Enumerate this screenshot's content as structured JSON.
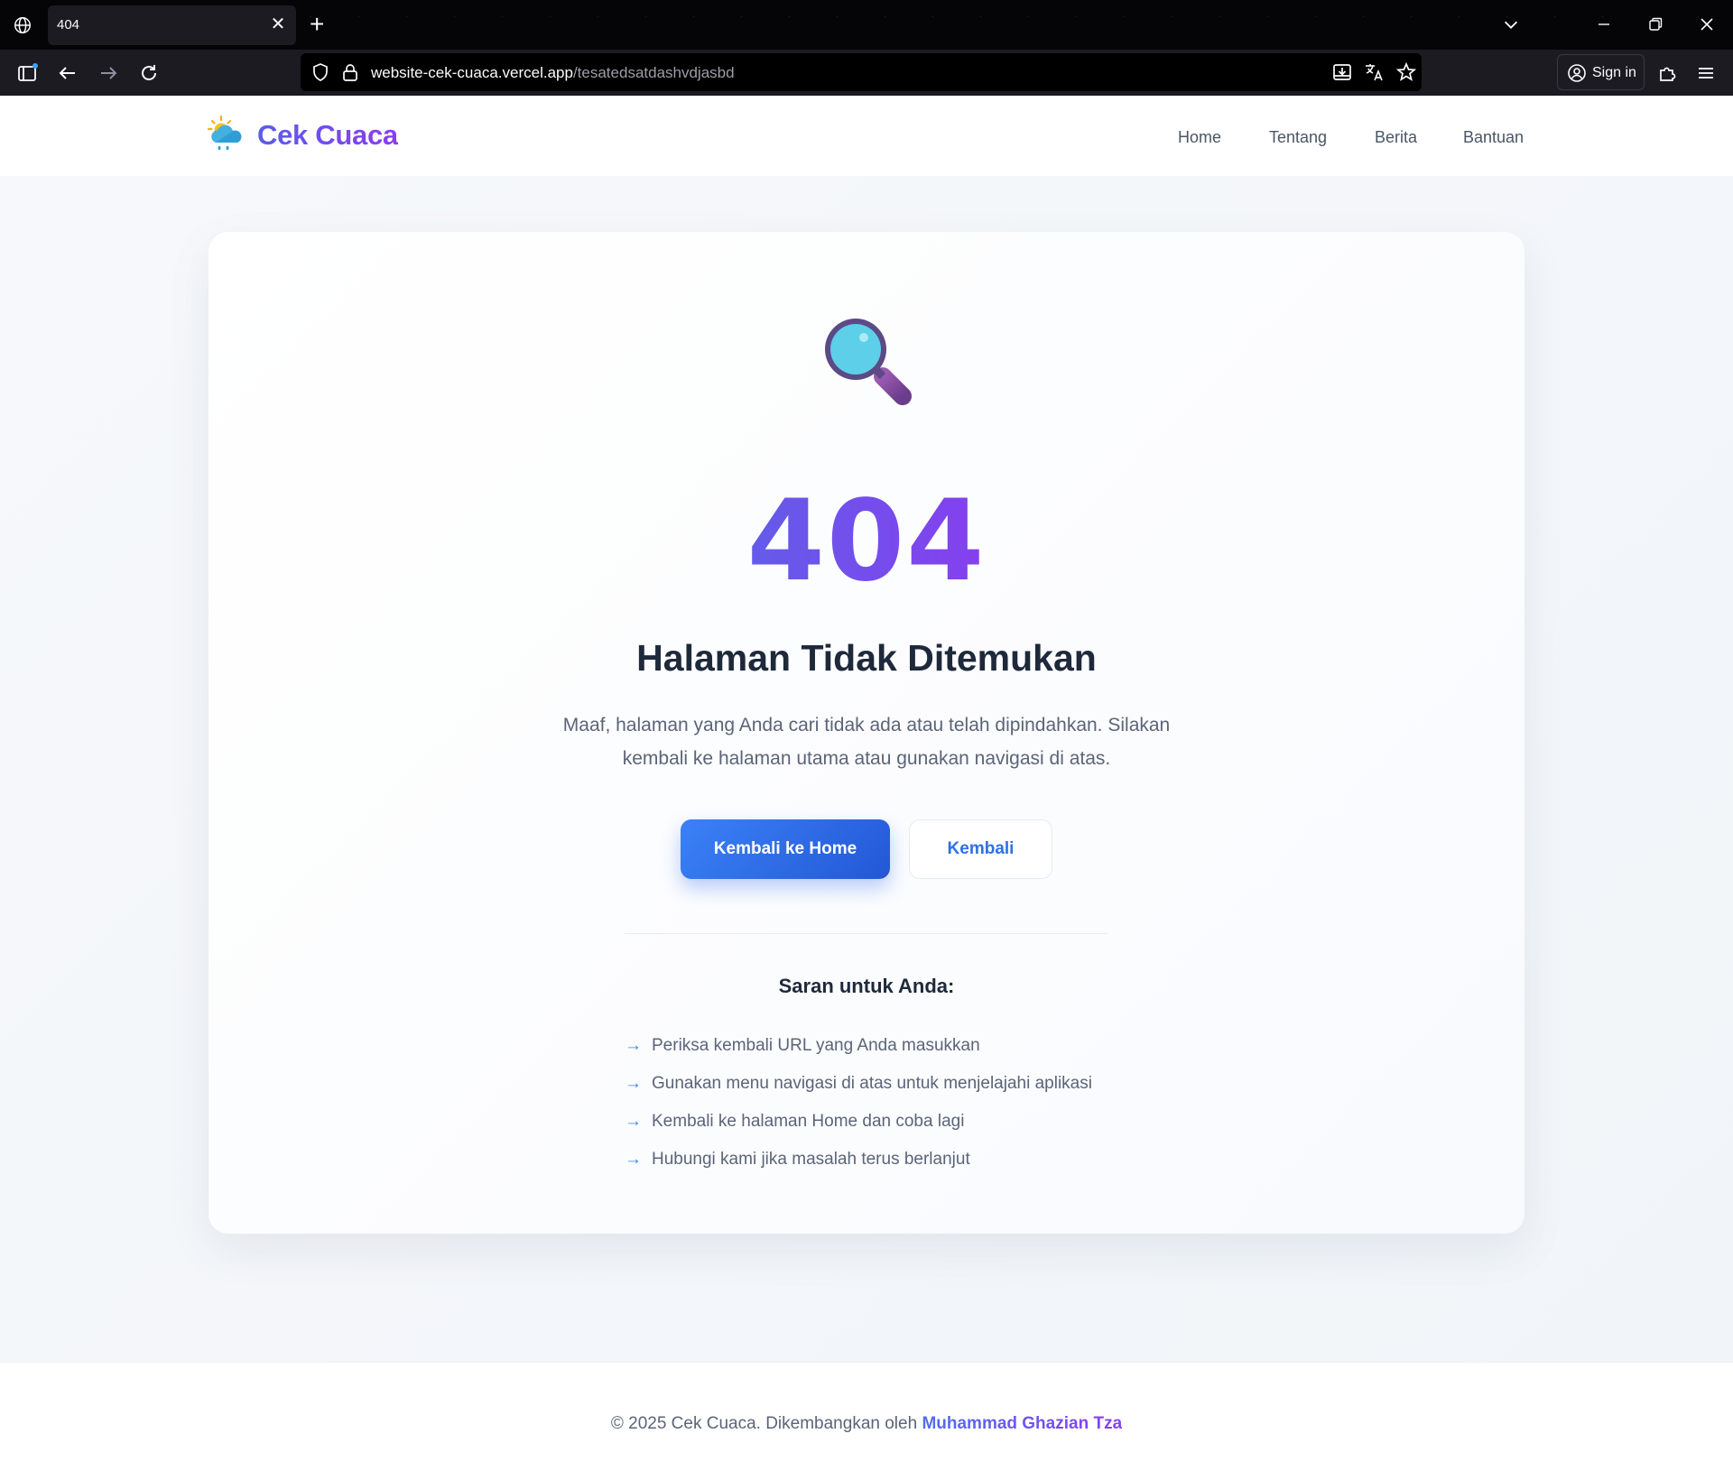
{
  "browser": {
    "tab_title": "404",
    "url_domain": "website-cek-cuaca.vercel.app",
    "url_path": "/tesatedsatdashvdjasbd",
    "signin_label": "Sign in"
  },
  "header": {
    "brand": "Cek Cuaca",
    "nav": [
      "Home",
      "Tentang",
      "Berita",
      "Bantuan"
    ]
  },
  "error": {
    "code": "404",
    "title": "Halaman Tidak Ditemukan",
    "description_line1": "Maaf, halaman yang Anda cari tidak ada atau telah dipindahkan. Silakan",
    "description_line2": "kembali ke halaman utama atau gunakan navigasi di atas.",
    "primary_button": "Kembali ke Home",
    "secondary_button": "Kembali"
  },
  "suggestions": {
    "title": "Saran untuk Anda:",
    "arrow": "→",
    "items": [
      "Periksa kembali URL yang Anda masukkan",
      "Gunakan menu navigasi di atas untuk menjelajahi aplikasi",
      "Kembali ke halaman Home dan coba lagi",
      "Hubungi kami jika masalah terus berlanjut"
    ]
  },
  "footer": {
    "text": "© 2025 Cek Cuaca. Dikembangkan oleh ",
    "author": "Muhammad Ghazian Tza"
  },
  "colors": {
    "brand_gradient_start": "#5b63e8",
    "brand_gradient_end": "#8e38f0",
    "primary_button": "#3b82f6",
    "heading": "#1e293b",
    "body_text": "#5b6478"
  },
  "icons": {
    "logo": "sun-cloud-rain-icon",
    "hero": "magnifying-glass-icon"
  }
}
